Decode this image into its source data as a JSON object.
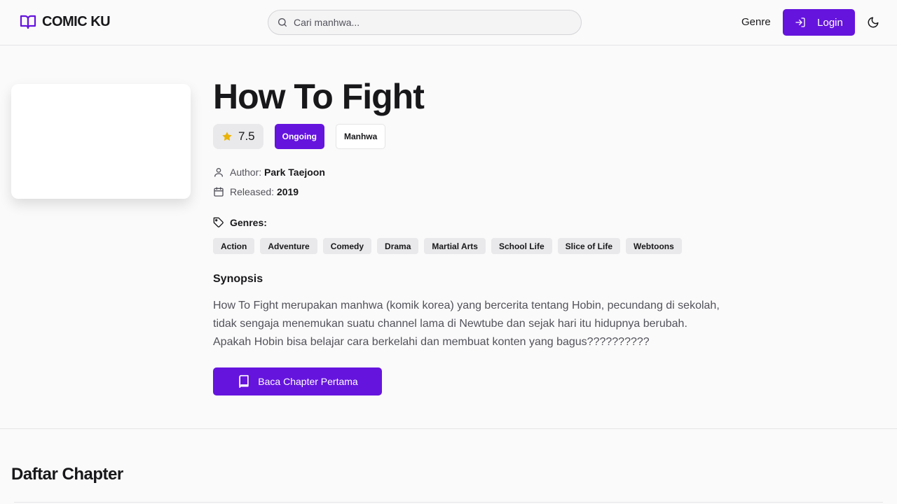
{
  "header": {
    "brand": "COMIC KU",
    "search_placeholder": "Cari manhwa...",
    "nav_genre": "Genre",
    "login_label": "Login"
  },
  "comic": {
    "title": "How To Fight",
    "rating": "7.5",
    "status": "Ongoing",
    "type": "Manhwa",
    "author_label": "Author:",
    "author": "Park Taejoon",
    "released_label": "Released:",
    "released": "2019",
    "genres_label": "Genres:",
    "genres": [
      "Action",
      "Adventure",
      "Comedy",
      "Drama",
      "Martial Arts",
      "School Life",
      "Slice of Life",
      "Webtoons"
    ],
    "synopsis_title": "Synopsis",
    "synopsis": "How To Fight merupakan manhwa (komik korea) yang bercerita tentang Hobin, pecundang di sekolah, tidak sengaja menemukan suatu channel lama di Newtube dan sejak hari itu hidupnya berubah. Apakah Hobin bisa belajar cara berkelahi dan membuat konten yang bagus??????????",
    "read_button": "Baca Chapter Pertama"
  },
  "chapters": {
    "title": "Daftar Chapter"
  },
  "colors": {
    "accent": "#6514dd",
    "star": "#eab308"
  }
}
